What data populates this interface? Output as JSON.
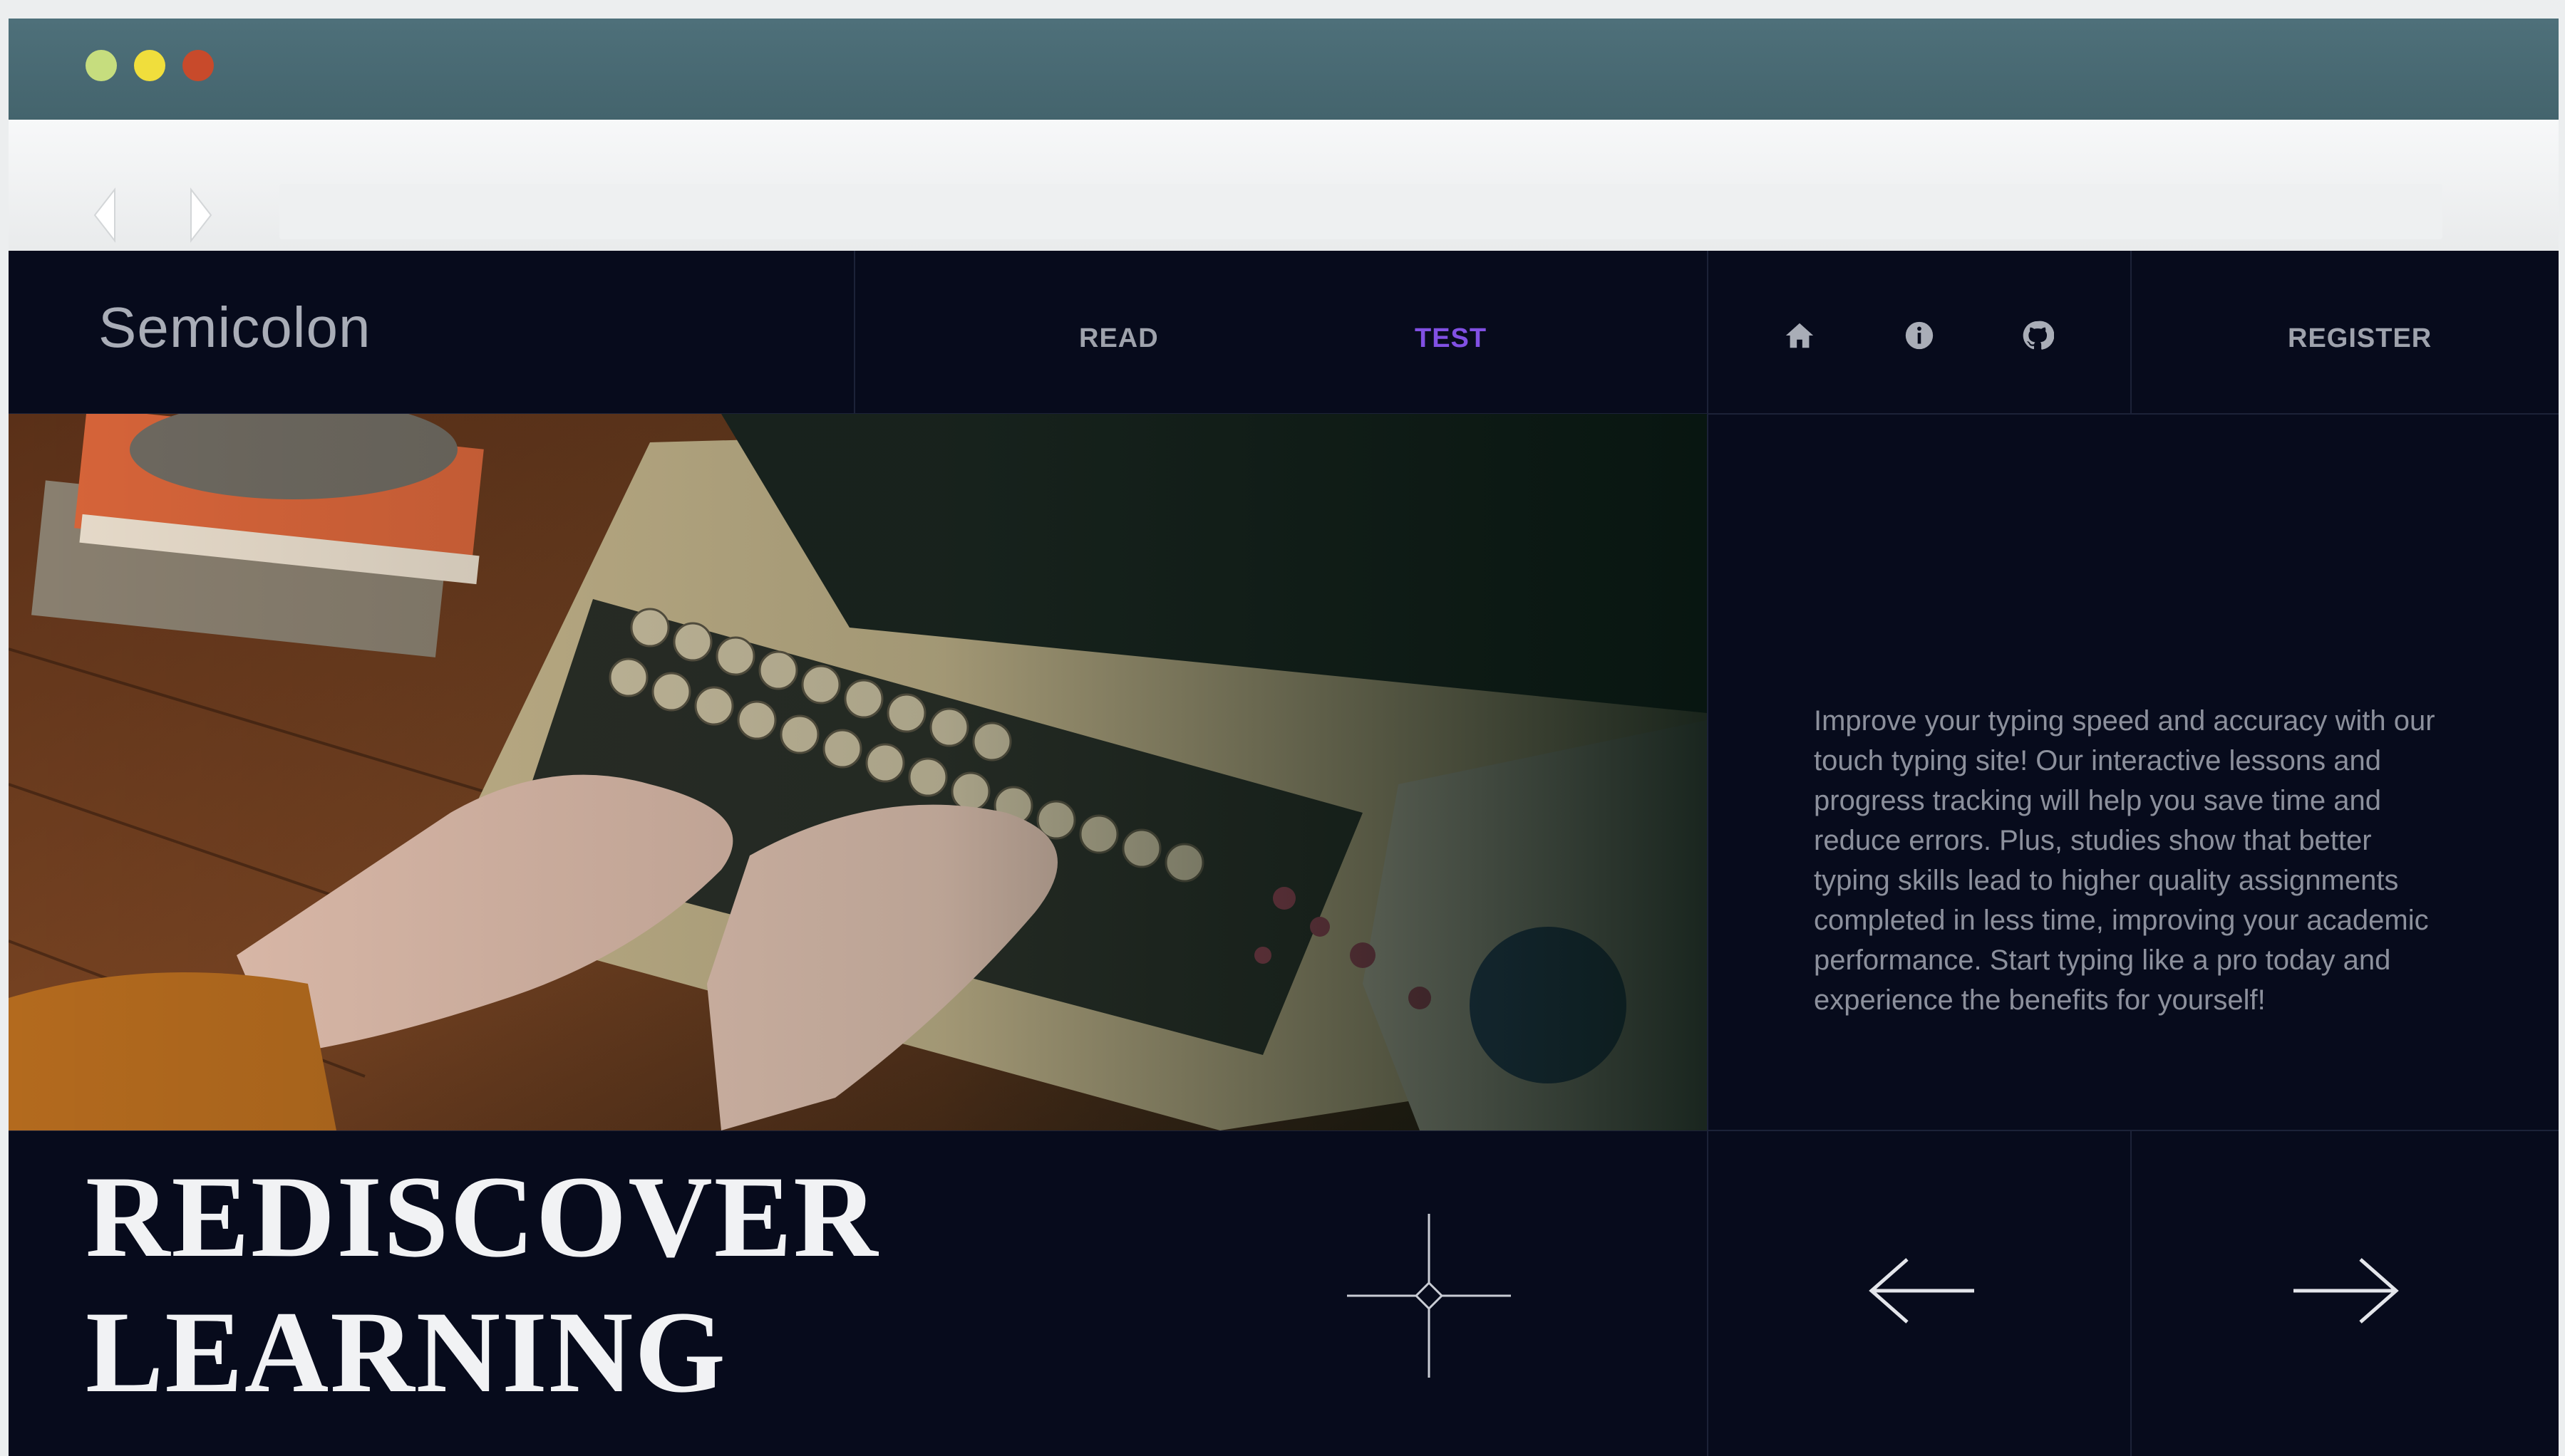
{
  "browser": {
    "controls": [
      "close",
      "minimize",
      "maximize"
    ],
    "url": ""
  },
  "site": {
    "logo": "Semicolon",
    "nav": {
      "read": "READ",
      "test": "TEST",
      "register": "REGISTER",
      "icons": [
        "home-icon",
        "info-icon",
        "github-icon"
      ]
    },
    "hero": {
      "image_alt": "Hands typing on a vintage typewriter",
      "description": "Improve your typing speed and accuracy with our touch typing site! Our interactive lessons and progress tracking will help you save time and reduce errors. Plus, studies show that better typing skills lead to higher quality assignments completed in less time, improving your academic performance. Start typing like a pro today and experience the benefits for yourself!",
      "headline_line1": "REDISCOVER",
      "headline_line2": "LEARNING"
    },
    "colors": {
      "background": "#070b1c",
      "active_link": "#8150e3",
      "grid_lines": "#1c2238"
    }
  }
}
